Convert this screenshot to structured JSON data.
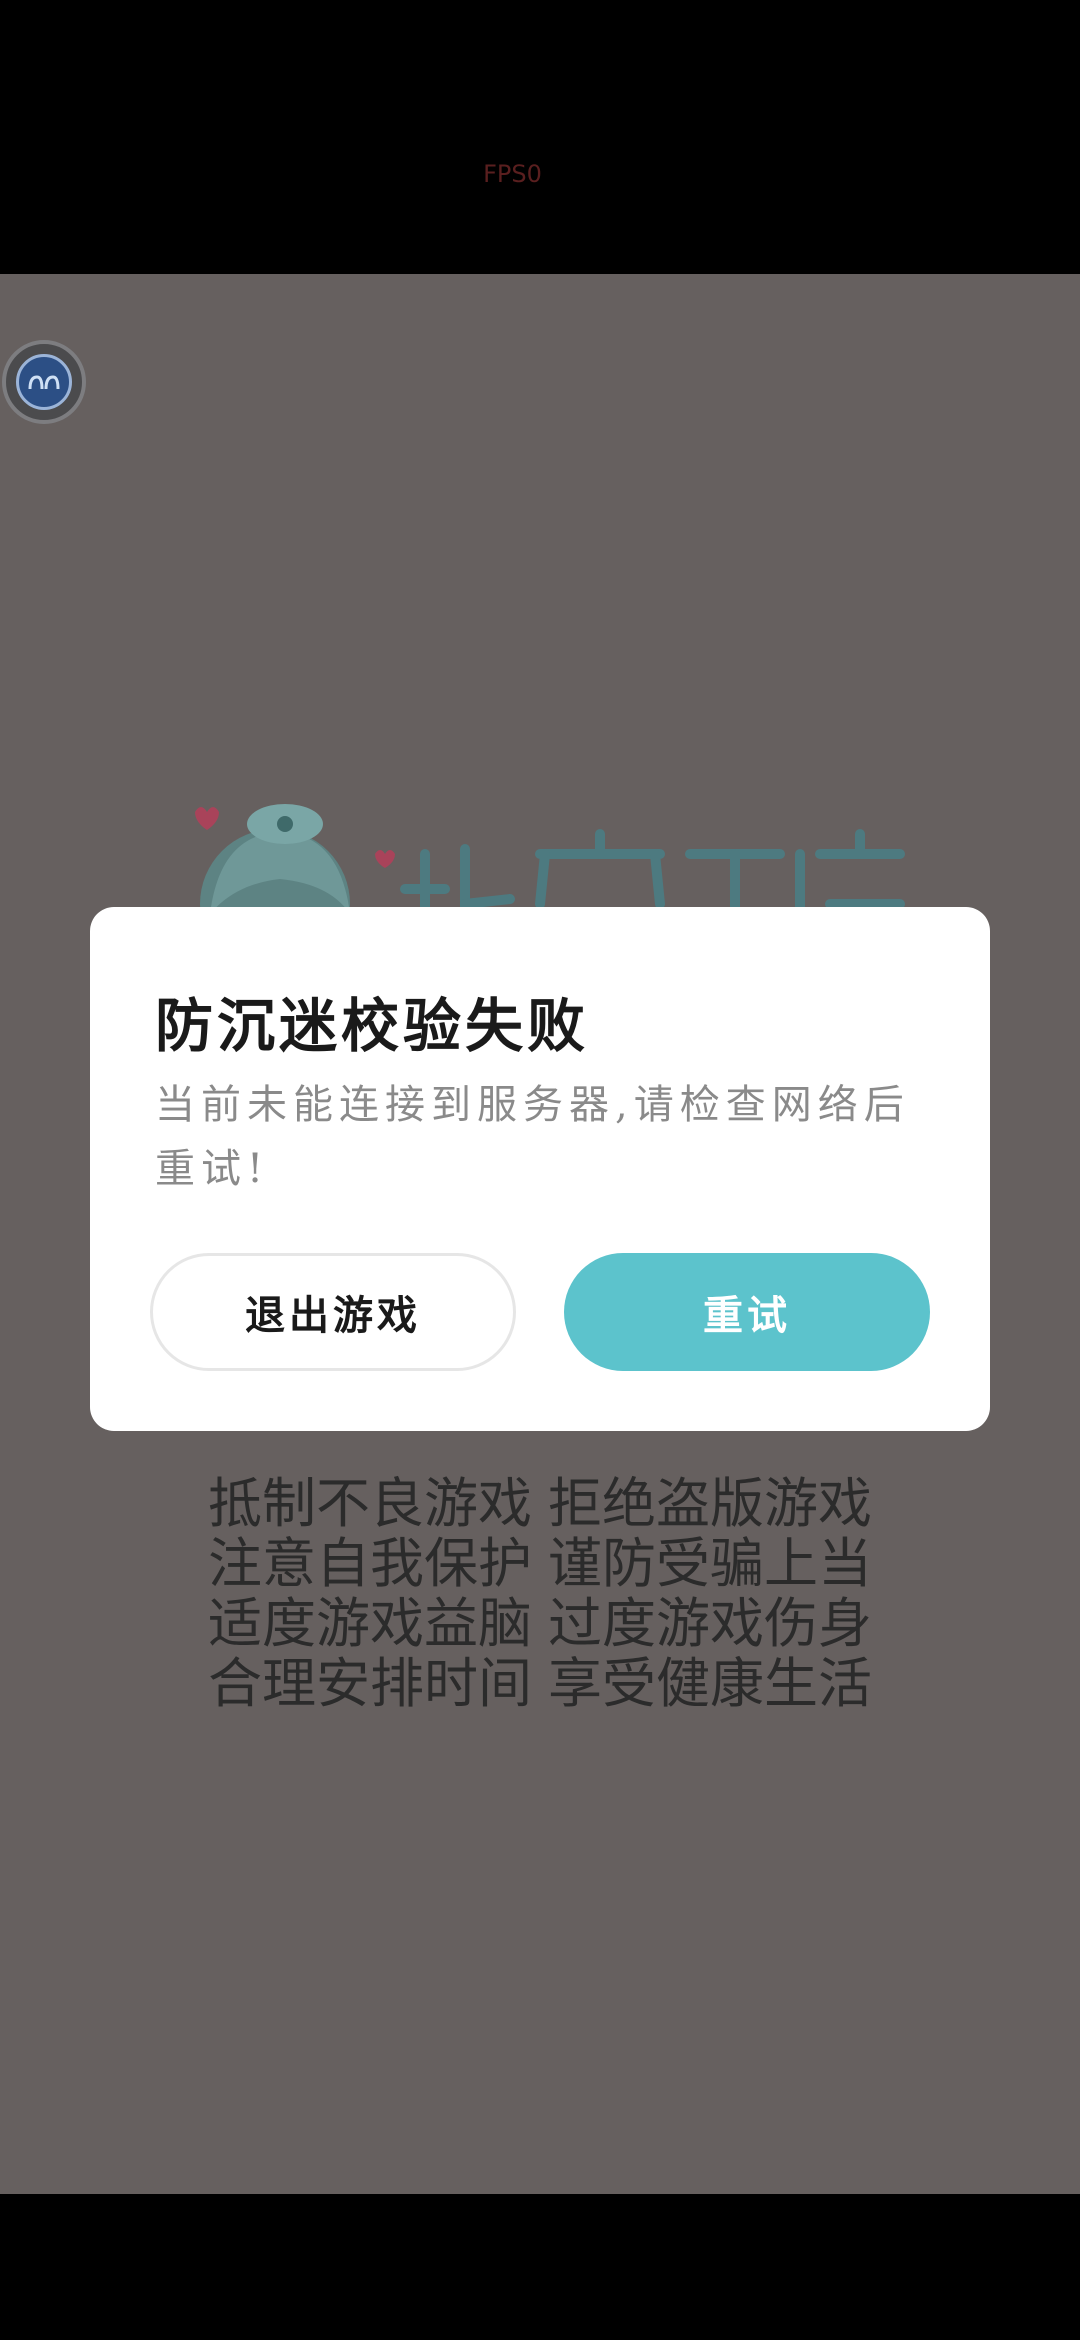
{
  "status": {
    "fps_text": "FPS0"
  },
  "dialog": {
    "title": "防沉迷校验失败",
    "message": "当前未能连接到服务器,请检查网络后重试!",
    "exit_button_label": "退出游戏",
    "retry_button_label": "重试"
  },
  "slogans": {
    "line1_left": "抵制不良游戏",
    "line1_right": "拒绝盗版游戏",
    "line2_left": "注意自我保护",
    "line2_right": "谨防受骗上当",
    "line3_left": "适度游戏益脑",
    "line3_right": "过度游戏伤身",
    "line4_left": "合理安排时间",
    "line4_right": "享受健康生活"
  },
  "icons": {
    "float_ball": "floating-assistant-icon",
    "logo": "game-logo"
  },
  "colors": {
    "overlay_bg": "#66605f",
    "retry_button": "#5cc3cc",
    "dialog_bg": "#ffffff"
  }
}
